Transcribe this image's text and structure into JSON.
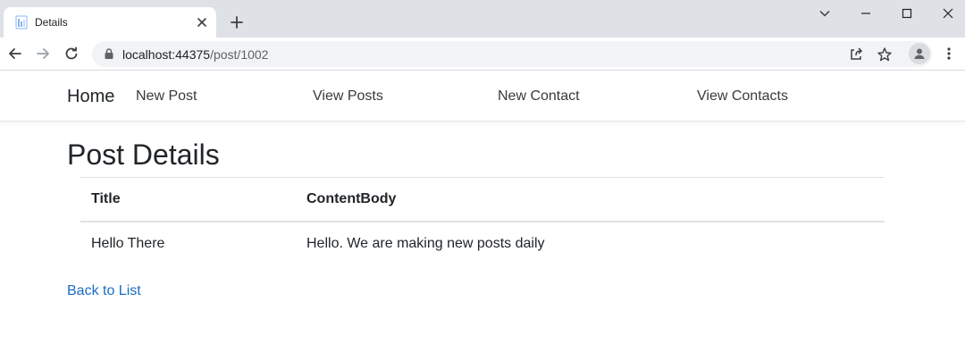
{
  "browser": {
    "tab_title": "Details",
    "url_host": "localhost:44375",
    "url_path": "/post/1002"
  },
  "site_nav": {
    "brand": "Home",
    "links": [
      "New Post",
      "View Posts",
      "New Contact",
      "View Contacts"
    ]
  },
  "page": {
    "title": "Post Details",
    "table": {
      "headers": [
        "Title",
        "ContentBody"
      ],
      "rows": [
        [
          "Hello There",
          "Hello. We are making new posts daily"
        ]
      ]
    },
    "back_link": "Back to List"
  },
  "colors": {
    "link": "#1b6ec2",
    "tabstrip": "#dee1e6",
    "omnibox": "#f1f3f4"
  }
}
